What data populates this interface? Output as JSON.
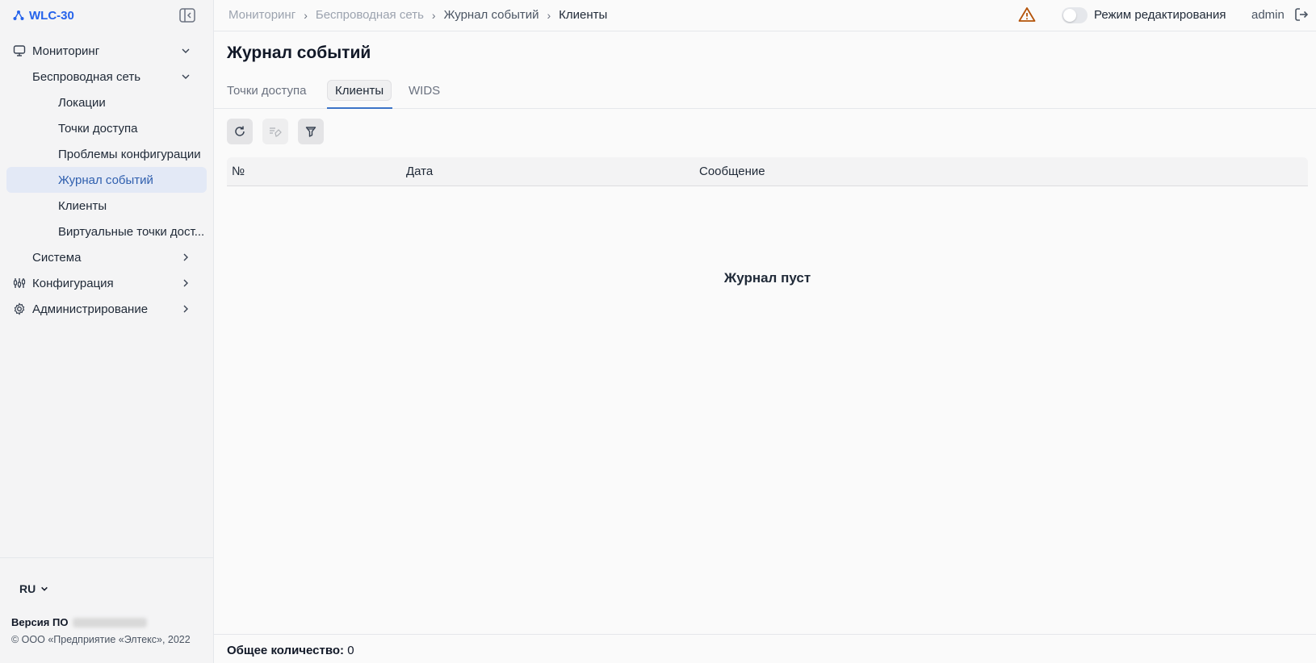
{
  "app": {
    "title": "WLC-30"
  },
  "sidebar": {
    "items": [
      {
        "label": "Мониторинг",
        "icon": "monitor-icon",
        "expanded": true
      },
      {
        "label": "Беспроводная сеть",
        "expanded": true
      },
      {
        "label": "Локации"
      },
      {
        "label": "Точки доступа"
      },
      {
        "label": "Проблемы конфигурации"
      },
      {
        "label": "Журнал событий",
        "active": true
      },
      {
        "label": "Клиенты"
      },
      {
        "label": "Виртуальные точки дост..."
      },
      {
        "label": "Система",
        "expanded": false
      },
      {
        "label": "Конфигурация",
        "icon": "sliders-icon",
        "expanded": false
      },
      {
        "label": "Администрирование",
        "icon": "gear-icon",
        "expanded": false
      }
    ],
    "language": "RU",
    "version_label": "Версия ПО",
    "copyright": "© ООО «Предприятие «Элтекс», 2022"
  },
  "header": {
    "breadcrumb": [
      "Мониторинг",
      "Беспроводная сеть",
      "Журнал событий",
      "Клиенты"
    ],
    "edit_mode_label": "Режим редактирования",
    "edit_mode_on": false,
    "user": "admin"
  },
  "main": {
    "title": "Журнал событий",
    "tabs": [
      {
        "label": "Точки доступа"
      },
      {
        "label": "Клиенты",
        "active": true
      },
      {
        "label": "WIDS"
      }
    ],
    "table": {
      "columns": [
        "№",
        "Дата",
        "Сообщение"
      ],
      "empty_text": "Журнал пуст"
    },
    "footer": {
      "total_label": "Общее количество:",
      "total_value": "0"
    }
  },
  "colors": {
    "accent": "#2563eb",
    "active_bg": "#e3e9f6",
    "warning": "#b45309"
  }
}
